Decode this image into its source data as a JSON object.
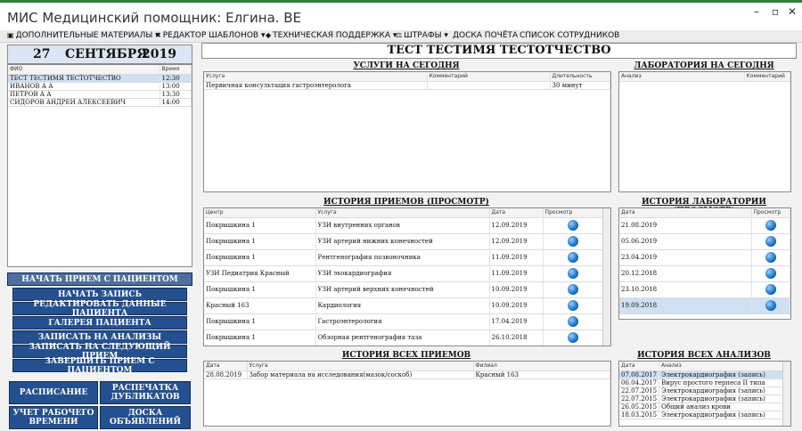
{
  "window": {
    "title": "МИС Медицинский помощник: Елгина. ВЕ"
  },
  "menu": [
    {
      "icon": "book-icon",
      "label": "ДОПОЛНИТЕЛЬНЫЕ МАТЕРИАЛЫ ▾"
    },
    {
      "icon": "tools-icon",
      "label": "РЕДАКТОР ШАБЛОНОВ ▾"
    },
    {
      "icon": "support-icon",
      "label": "ТЕХНИЧЕСКАЯ ПОДДЕРЖКА ▾"
    },
    {
      "icon": "fine-icon",
      "label": "ШТРАФЫ ▾"
    },
    {
      "icon": "",
      "label": "ДОСКА ПОЧЁТА"
    },
    {
      "icon": "",
      "label": "СПИСОК СОТРУДНИКОВ"
    }
  ],
  "date": {
    "day": "27",
    "month": "СЕНТЯБРЯ",
    "year": "2019"
  },
  "queue": {
    "col_name": "ФИО",
    "col_time": "Время",
    "rows": [
      {
        "name": "ТЕСТ ТЕСТИМЯ ТЕСТОТЧЕСТВО",
        "time": "12:30"
      },
      {
        "name": "ИВАНОВ А А",
        "time": "13:00"
      },
      {
        "name": "ПЕТРОВ А А",
        "time": "13:30"
      },
      {
        "name": "СИДОРОВ АНДРЕЙ АЛЕКСЕЕВИЧ",
        "time": "14:00"
      }
    ]
  },
  "patient_name": "ТЕСТ ТЕСТИМЯ ТЕСТОТЧЕСТВО",
  "actions": [
    "НАЧАТЬ ПРИЕМ С ПАЦИЕНТОМ",
    "НАЧАТЬ ЗАПИСЬ",
    "РЕДАКТИРОВАТЬ ДАННЫЕ ПАЦИЕНТА",
    "ГАЛЕРЕЯ ПАЦИЕНТА",
    "ЗАПИСАТЬ НА АНАЛИЗЫ",
    "ЗАПИСАТЬ НА СЛЕДУЮЩИЙ ПРИЕМ",
    "ЗАВЕРШИТЬ ПРИЕМ С ПАЦИЕНТОМ"
  ],
  "bottom_buttons": [
    "РАСПИСАНИЕ",
    "РАСПЕЧАТКА ДУБЛИКАТОВ",
    "УЧЕТ РАБОЧЕГО ВРЕМЕНИ",
    "ДОСКА ОБЪЯВЛЕНИЙ"
  ],
  "services_today": {
    "title": "УСЛУГИ НА СЕГОДНЯ",
    "cols": [
      "Услуга",
      "Комментарий",
      "Длительность"
    ],
    "rows": [
      {
        "service": "Первичная консультация гастроэнтеролога",
        "comment": "",
        "duration": "30 минут"
      }
    ]
  },
  "lab_today": {
    "title": "ЛАБОРАТОРИЯ НА СЕГОДНЯ",
    "cols": [
      "Анализ",
      "Комментарий"
    ]
  },
  "visit_history": {
    "title": "ИСТОРИЯ ПРИЕМОВ (ПРОСМОТР)",
    "cols": [
      "Центр",
      "Услуга",
      "Дата",
      "Просмотр"
    ],
    "rows": [
      {
        "center": "Покрышкина 1",
        "service": "УЗИ внутренних органов",
        "date": "12.09.2019"
      },
      {
        "center": "Покрышкина 1",
        "service": "УЗИ артерий нижних конечностей",
        "date": "12.09.2019"
      },
      {
        "center": "Покрышкина 1",
        "service": "Рентгенография позвоночника",
        "date": "11.09.2019"
      },
      {
        "center": "УЗИ Педиатрия Красный",
        "service": "УЗИ эхокардиография",
        "date": "11.09.2019"
      },
      {
        "center": "Покрышкина 1",
        "service": "УЗИ артерий верхних конечностей",
        "date": "10.09.2019"
      },
      {
        "center": "Красный 163",
        "service": "Кардиология",
        "date": "10.09.2019"
      },
      {
        "center": "Покрышкина 1",
        "service": "Гастроэнтерология",
        "date": "17.04.2019"
      },
      {
        "center": "Покрышкина 1",
        "service": "Обзорная рентгенография таза",
        "date": "26.10.2018"
      }
    ]
  },
  "lab_history": {
    "title": "ИСТОРИЯ ЛАБОРАТОРИИ (ПРОСМОТР)",
    "cols": [
      "Дата",
      "Просмотр"
    ],
    "rows": [
      "21.08.2019",
      "05.06.2019",
      "23.04.2019",
      "20.12.2018",
      "23.10.2018",
      "19.09.2018"
    ]
  },
  "all_visits": {
    "title": "ИСТОРИЯ ВСЕХ ПРИЕМОВ",
    "cols": [
      "Дата",
      "Услуга",
      "Филиал"
    ],
    "rows": [
      {
        "date": "28.08.2019",
        "service": "Забор материала на исследования(мазок/соскоб)",
        "branch": "Красный 163"
      }
    ]
  },
  "all_analyses": {
    "title": "ИСТОРИЯ ВСЕХ АНАЛИЗОВ",
    "cols": [
      "Дата",
      "Анализ"
    ],
    "rows": [
      {
        "date": "07.08.2017",
        "name": "Электрокардиография (запись)"
      },
      {
        "date": "06.04.2017",
        "name": "Вирус простого герпеса II типа"
      },
      {
        "date": "22.07.2015",
        "name": "Электрокардиография (запись)"
      },
      {
        "date": "22.07.2015",
        "name": "Электрокардиография (запись)"
      },
      {
        "date": "26.05.2015",
        "name": "Общий анализ крови"
      },
      {
        "date": "18.03.2015",
        "name": "Электрокардиография (запись)"
      }
    ]
  }
}
